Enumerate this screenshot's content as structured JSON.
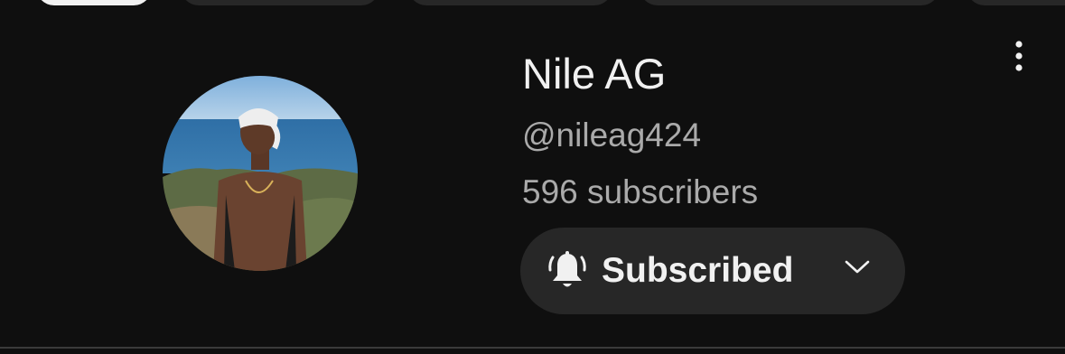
{
  "channel": {
    "name": "Nile AG",
    "handle": "@nileag424",
    "subscribers": "596 subscribers"
  },
  "subscribe_button": {
    "label": "Subscribed",
    "bell_icon": "bell-ringing-icon",
    "chevron_icon": "chevron-down-icon"
  },
  "more_icon": "more-vert-icon",
  "colors": {
    "background": "#0f0f0f",
    "button_bg": "#272727",
    "primary_text": "#f1f1f1",
    "secondary_text": "#aaaaaa"
  }
}
